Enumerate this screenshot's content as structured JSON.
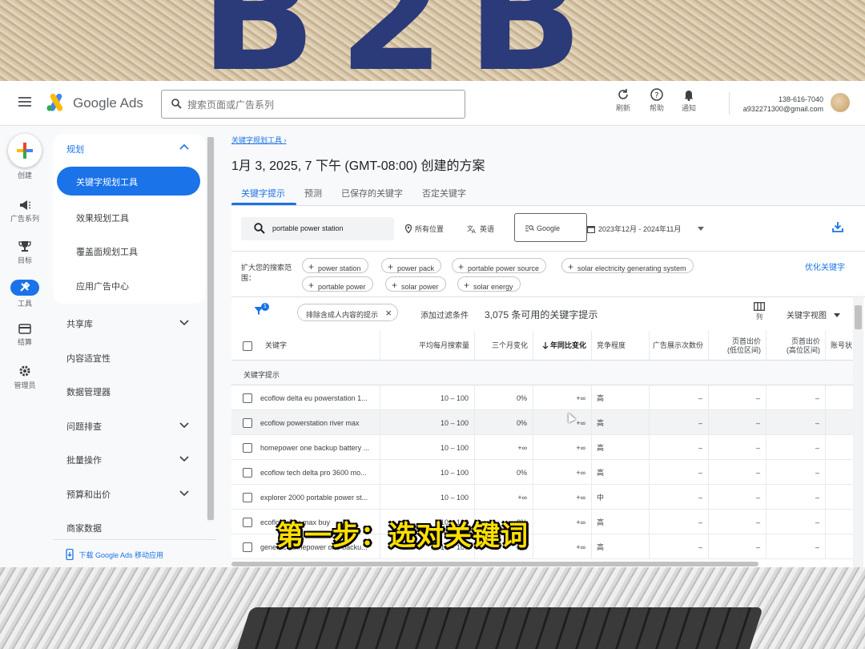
{
  "backdrop": {
    "top_text": "B2B",
    "subtitle": "第一步：选对关键词"
  },
  "header": {
    "brand": "Google Ads",
    "search_placeholder": "搜索页面或广告系列",
    "refresh": "刷新",
    "help": "帮助",
    "notifications": "通知",
    "account_id": "138-616-7040",
    "account_email": "a932271300@gmail.com"
  },
  "rail": {
    "create": "创建",
    "campaigns": "广告系列",
    "goals": "目标",
    "tools": "工具",
    "billing": "结算",
    "admin": "管理员"
  },
  "nav": {
    "planning": "规划",
    "items": [
      "关键字规划工具",
      "效果规划工具",
      "覆盖面规划工具",
      "应用广告中心"
    ],
    "sections": [
      "共享库",
      "内容适宜性",
      "数据管理器",
      "问题排查",
      "批量操作",
      "预算和出价",
      "商家数据"
    ],
    "footer_link": "下载 Google Ads 移动应用"
  },
  "main": {
    "breadcrumb": "关键字规划工具",
    "title": "1月 3, 2025, 7 下午 (GMT-08:00) 创建的方案",
    "tabs": [
      "关键字提示",
      "预测",
      "已保存的关键字",
      "否定关键字"
    ],
    "keyword_query": "portable power station",
    "location": "所有位置",
    "language": "英语",
    "network": "Google",
    "date_range": "2023年12月 - 2024年11月",
    "expand_label": "扩大您的搜索范围：",
    "expand_chips": [
      "power station",
      "power pack",
      "portable power source",
      "solar electricity generating system",
      "portable power",
      "solar power",
      "solar energy"
    ],
    "refine": "优化关键字",
    "filter_count": "1",
    "filter_chip": "排除含成人内容的提示",
    "add_filter": "添加过滤条件",
    "result_count": "3,075 条可用的关键字提示",
    "columns_label": "列",
    "view_select": "关键字视图",
    "table": {
      "headers": [
        "关键字",
        "平均每月搜索量",
        "三个月变化",
        "年同比变化",
        "竞争程度",
        "广告展示次数份",
        "页首出价\n(低位区间)",
        "页首出价\n(高位区间)",
        "账号状"
      ],
      "group_label": "关键字提示",
      "rows": [
        [
          "ecoflow delta eu powerstation 1...",
          "10 – 100",
          "0%",
          "+∞",
          "高",
          "–",
          "–",
          "–"
        ],
        [
          "ecoflow powerstation river max",
          "10 – 100",
          "0%",
          "+∞",
          "高",
          "–",
          "–",
          "–"
        ],
        [
          "homepower one backup battery ...",
          "10 – 100",
          "+∞",
          "+∞",
          "高",
          "–",
          "–",
          "–"
        ],
        [
          "ecoflow tech delta pro 3600 mo...",
          "10 – 100",
          "0%",
          "+∞",
          "高",
          "–",
          "–",
          "–"
        ],
        [
          "explorer 2000 portable power st...",
          "10 – 100",
          "+∞",
          "+∞",
          "中",
          "–",
          "–",
          "–"
        ],
        [
          "ecoflow river max buy",
          "10 – 100",
          "0%",
          "+∞",
          "高",
          "–",
          "–",
          "–"
        ],
        [
          "generac homepower one backu...",
          "10 – 100",
          "0%",
          "+∞",
          "高",
          "–",
          "–",
          "–"
        ]
      ]
    }
  },
  "colors": {
    "accent": "#1a73e8",
    "subtitle": "#ffe000"
  }
}
